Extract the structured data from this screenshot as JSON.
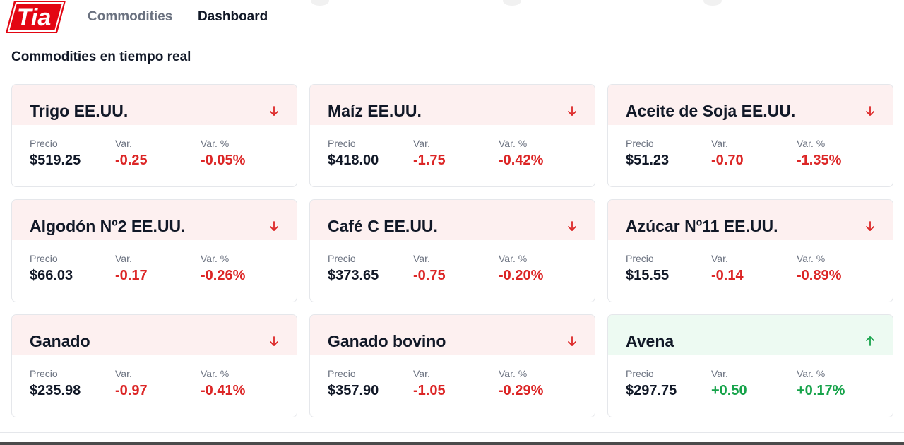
{
  "brand": {
    "logo_text": "TIA",
    "logo_color": "#e30613"
  },
  "nav": {
    "commodities_label": "Commodities",
    "dashboard_label": "Dashboard"
  },
  "page": {
    "title": "Commodities en tiempo real"
  },
  "labels": {
    "price": "Precio",
    "change": "Var.",
    "change_pct": "Var. %"
  },
  "colors": {
    "negative": "#dc2626",
    "positive": "#16a34a",
    "neg_header_bg": "#fdf0f0",
    "pos_header_bg": "#edfaf2"
  },
  "commodities": [
    {
      "name": "Trigo EE.UU.",
      "price": "$519.25",
      "change": "-0.25",
      "change_pct": "-0.05%",
      "trend": "down",
      "icon": "arrow-down-icon"
    },
    {
      "name": "Maíz EE.UU.",
      "price": "$418.00",
      "change": "-1.75",
      "change_pct": "-0.42%",
      "trend": "down",
      "icon": "arrow-down-icon"
    },
    {
      "name": "Aceite de Soja EE.UU.",
      "price": "$51.23",
      "change": "-0.70",
      "change_pct": "-1.35%",
      "trend": "down",
      "icon": "arrow-down-icon"
    },
    {
      "name": "Algodón Nº2 EE.UU.",
      "price": "$66.03",
      "change": "-0.17",
      "change_pct": "-0.26%",
      "trend": "down",
      "icon": "arrow-down-icon"
    },
    {
      "name": "Café C EE.UU.",
      "price": "$373.65",
      "change": "-0.75",
      "change_pct": "-0.20%",
      "trend": "down",
      "icon": "arrow-down-icon"
    },
    {
      "name": "Azúcar Nº11 EE.UU.",
      "price": "$15.55",
      "change": "-0.14",
      "change_pct": "-0.89%",
      "trend": "down",
      "icon": "arrow-down-icon"
    },
    {
      "name": "Ganado",
      "price": "$235.98",
      "change": "-0.97",
      "change_pct": "-0.41%",
      "trend": "down",
      "icon": "arrow-down-icon"
    },
    {
      "name": "Ganado bovino",
      "price": "$357.90",
      "change": "-1.05",
      "change_pct": "-0.29%",
      "trend": "down",
      "icon": "arrow-down-icon"
    },
    {
      "name": "Avena",
      "price": "$297.75",
      "change": "+0.50",
      "change_pct": "+0.17%",
      "trend": "up",
      "icon": "arrow-up-icon"
    }
  ]
}
